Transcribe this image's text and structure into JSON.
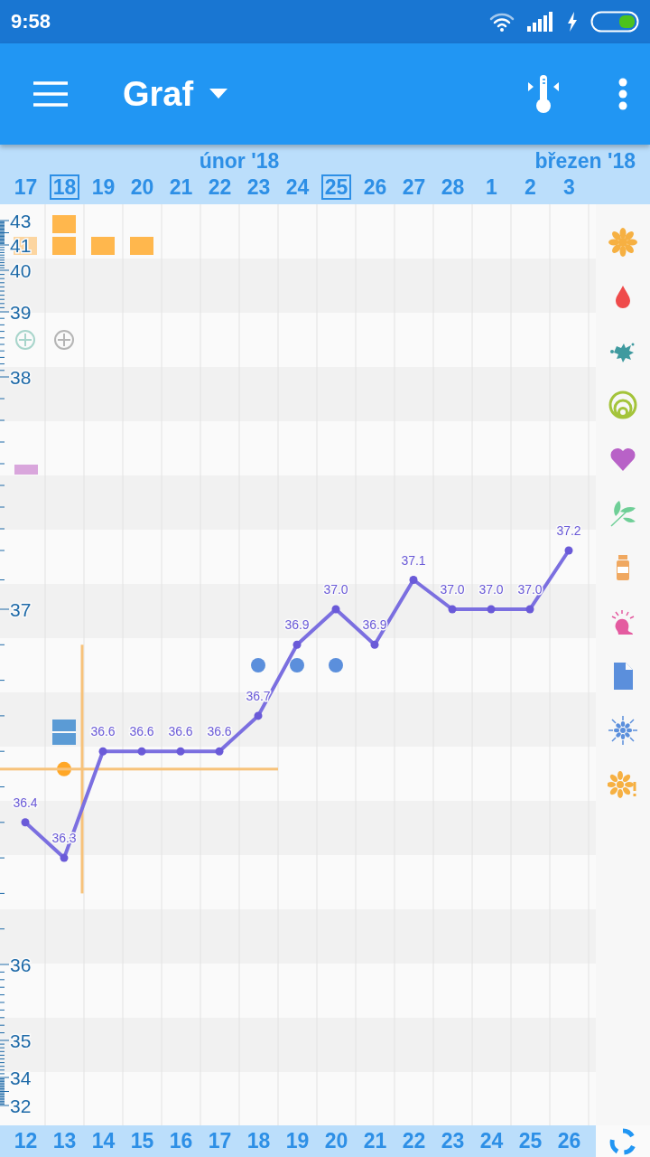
{
  "status_bar": {
    "time": "9:58"
  },
  "app_bar": {
    "title": "Graf"
  },
  "header": {
    "months": [
      {
        "label": "únor '18"
      },
      {
        "label": "březen '18"
      }
    ],
    "dates": [
      {
        "label": "17",
        "highlighted": false
      },
      {
        "label": "18",
        "highlighted": true
      },
      {
        "label": "19",
        "highlighted": false
      },
      {
        "label": "20",
        "highlighted": false
      },
      {
        "label": "21",
        "highlighted": false
      },
      {
        "label": "22",
        "highlighted": false
      },
      {
        "label": "23",
        "highlighted": false
      },
      {
        "label": "24",
        "highlighted": false
      },
      {
        "label": "25",
        "highlighted": true
      },
      {
        "label": "26",
        "highlighted": false
      },
      {
        "label": "27",
        "highlighted": false
      },
      {
        "label": "28",
        "highlighted": false
      },
      {
        "label": "1",
        "highlighted": false
      },
      {
        "label": "2",
        "highlighted": false
      },
      {
        "label": "3",
        "highlighted": false
      }
    ]
  },
  "chart": {
    "y_axis": [
      "43",
      "41",
      "40",
      "39",
      "38",
      "37",
      "36",
      "35",
      "34",
      "32"
    ],
    "days": [
      {
        "label": "12",
        "reading": "36.4",
        "markers": [
          {
            "kind": "lower-square",
            "color": "#fcd5a0"
          },
          {
            "kind": "circle",
            "color": "#a8d5cb"
          },
          {
            "kind": "bar",
            "color": "#d9a6dc"
          }
        ]
      },
      {
        "label": "13",
        "reading": "36.3",
        "markers": [
          {
            "kind": "upper-square",
            "color": "#ffb74d"
          },
          {
            "kind": "lower-square",
            "color": "#ffb74d"
          },
          {
            "kind": "circle",
            "color": "#b5b5b5"
          },
          {
            "kind": "split-square",
            "color": "#5b9bd5"
          },
          {
            "kind": "ovulation-line",
            "color": "#f7c27a"
          },
          {
            "kind": "marker-dot",
            "color": "#ffa726"
          }
        ]
      },
      {
        "label": "14",
        "reading": "36.6",
        "markers": [
          {
            "kind": "lower-square",
            "color": "#ffb74d"
          }
        ]
      },
      {
        "label": "15",
        "reading": "36.6",
        "markers": [
          {
            "kind": "lower-square",
            "color": "#ffb74d"
          }
        ]
      },
      {
        "label": "16",
        "reading": "36.6"
      },
      {
        "label": "17",
        "reading": "36.6"
      },
      {
        "label": "18",
        "reading": "36.7",
        "markers": [
          {
            "kind": "dot",
            "color": "#5b8fdc"
          },
          {
            "kind": "coverline",
            "color": "#f7c27a"
          }
        ]
      },
      {
        "label": "19",
        "reading": "36.9",
        "markers": [
          {
            "kind": "dot",
            "color": "#5b8fdc"
          }
        ]
      },
      {
        "label": "20",
        "reading": "37.0",
        "markers": [
          {
            "kind": "dot",
            "color": "#5b8fdc"
          }
        ]
      },
      {
        "label": "21",
        "reading": "36.9"
      },
      {
        "label": "22",
        "reading": "37.1"
      },
      {
        "label": "23",
        "reading": "37.0"
      },
      {
        "label": "24",
        "reading": "37.0"
      },
      {
        "label": "25",
        "reading": "37.0"
      },
      {
        "label": "26",
        "reading": "37.2"
      }
    ]
  }
}
